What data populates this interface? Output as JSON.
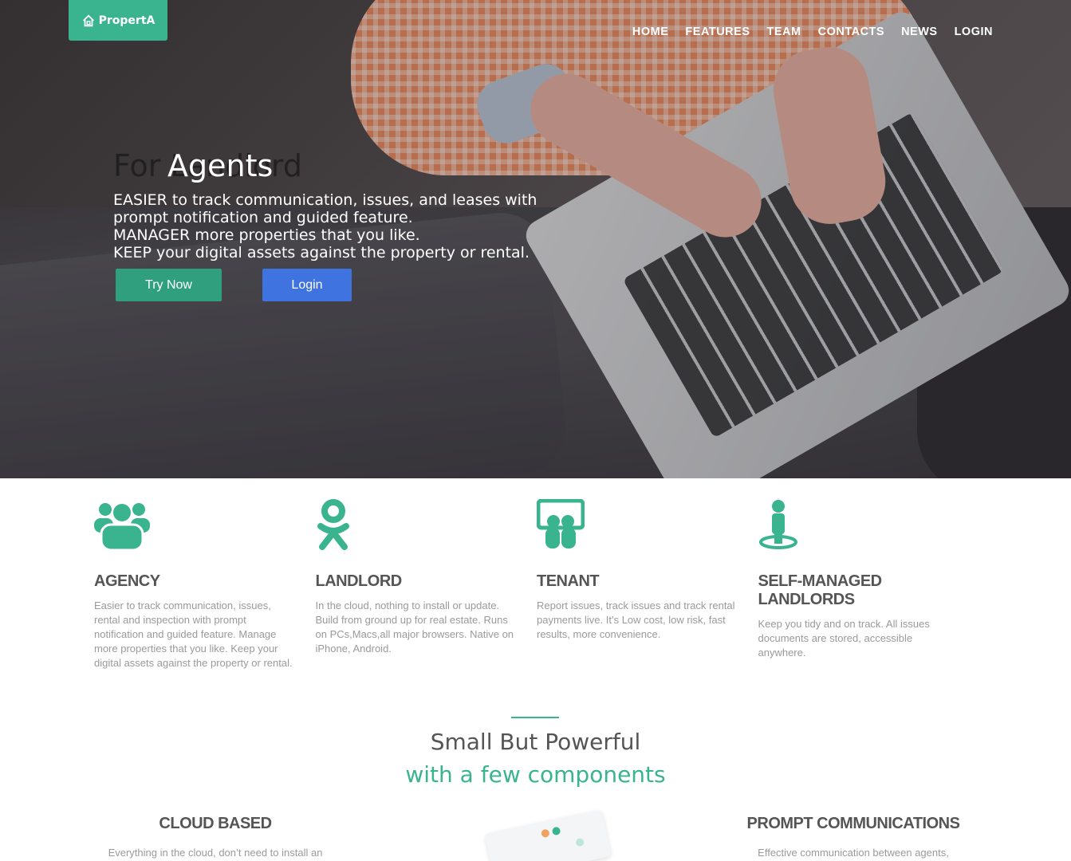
{
  "brand": {
    "name": "PropertA",
    "accent": "#3ab48f",
    "try_color": "#2f9f7e",
    "login_color": "#3f73e0"
  },
  "nav": {
    "items": [
      "HOME",
      "FEATURES",
      "TEAM",
      "CONTACTS",
      "NEWS",
      "LOGIN"
    ]
  },
  "hero": {
    "title_back": "For Landlord",
    "title_front": "Agents",
    "lines": [
      "EASIER to track communication, issues, and leases with",
      "prompt notification and guided feature.",
      "MANAGER more properties that you like.",
      "KEEP your digital assets against the property or rental."
    ],
    "try_label": "Try Now",
    "login_label": "Login"
  },
  "features": [
    {
      "icon": "users-group-icon",
      "title": "AGENCY",
      "text": "Easier to track communication, issues, rental and inspection with prompt notification and guided feature. Manage more properties that you like. Keep your digital assets against the property or rental."
    },
    {
      "icon": "odnoklassniki-person-icon",
      "title": "LANDLORD",
      "text": "In the cloud, nothing to install or update. Build from ground up for real estate. Runs on PCs,Macs,all major browsers. Native on iPhone, Android."
    },
    {
      "icon": "presentation-board-icon",
      "title": "TENANT",
      "text": "Report issues, track issues and track rental payments live. It’s Low cost, low risk, fast results, more convenience."
    },
    {
      "icon": "person-location-icon",
      "title": "SELF-MANAGED LANDLORDS",
      "text": "Keep you tidy and on track. All issues documents are stored, accessible anywhere."
    }
  ],
  "section": {
    "title": "Small But Powerful",
    "subtitle": "with a few components"
  },
  "bottom": {
    "left": {
      "title": "CLOUD BASED",
      "text": "Everything in the cloud, don’t need to install an"
    },
    "right": {
      "title": "PROMPT COMMUNICATIONS",
      "text": "Effective communication between agents,"
    }
  }
}
